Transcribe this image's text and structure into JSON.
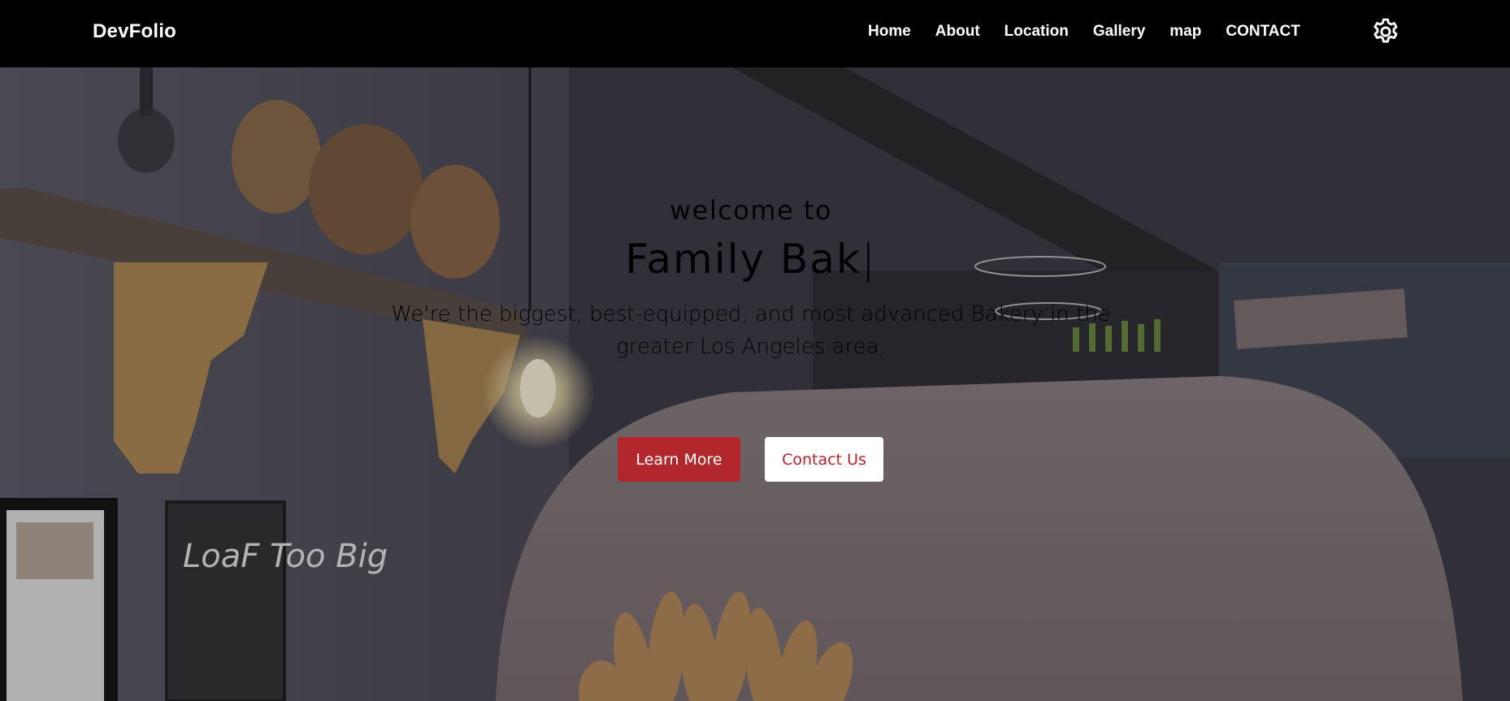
{
  "nav": {
    "brand": "DevFolio",
    "links": [
      "Home",
      "About",
      "Location",
      "Gallery",
      "map",
      "CONTACT"
    ],
    "settings_icon": "gear-icon"
  },
  "hero": {
    "welcome": "welcome to",
    "headline": "Family Bak",
    "cursor": "|",
    "tagline": "We're the biggest, best-equipped, and most advanced Bakery in the greater Los Angeles area.",
    "primary_button": "Learn More",
    "secondary_button": "Contact Us",
    "chalkboard_text": "LoaF Too Big"
  },
  "colors": {
    "nav_bg": "#000000",
    "accent": "#b1272c",
    "text": "#ffffff"
  }
}
